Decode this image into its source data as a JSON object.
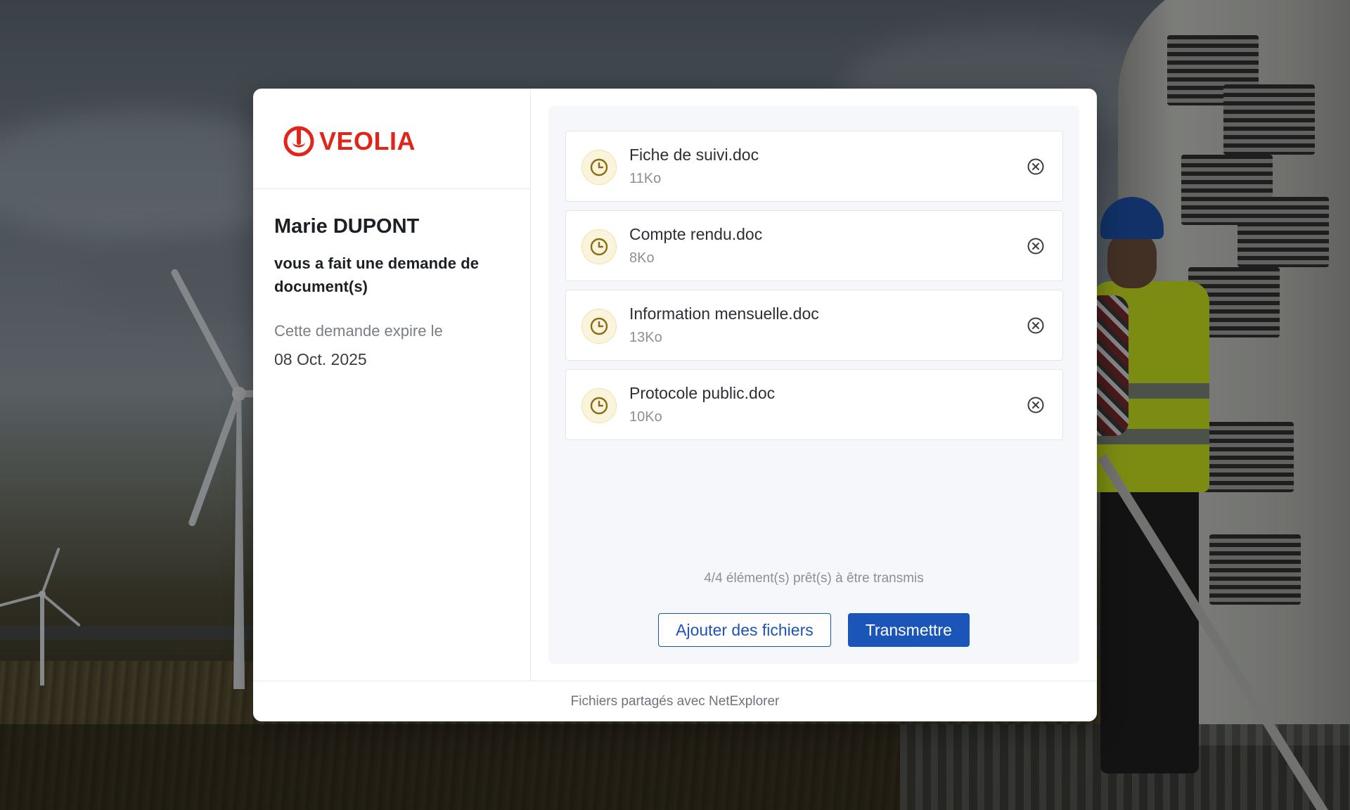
{
  "brand": {
    "name": "VEOLIA",
    "color": "#e1251b"
  },
  "request": {
    "requester_name": "Marie DUPONT",
    "message": "vous a fait une demande de document(s)",
    "expire_label": "Cette demande expire le",
    "expire_date": "08 Oct. 2025"
  },
  "files": [
    {
      "name": "Fiche de suivi.doc",
      "size": "11Ko",
      "status_icon": "clock-icon"
    },
    {
      "name": "Compte rendu.doc",
      "size": "8Ko",
      "status_icon": "clock-icon"
    },
    {
      "name": "Information mensuelle.doc",
      "size": "13Ko",
      "status_icon": "clock-icon"
    },
    {
      "name": "Protocole public.doc",
      "size": "10Ko",
      "status_icon": "clock-icon"
    }
  ],
  "status": {
    "ready_text": "4/4 élément(s) prêt(s) à être transmis"
  },
  "actions": {
    "add_files_label": "Ajouter des fichiers",
    "submit_label": "Transmettre"
  },
  "footer": {
    "text": "Fichiers partagés avec NetExplorer"
  },
  "colors": {
    "accent": "#1b55b8",
    "pending_icon": "#8a6d12",
    "pending_bg": "#fbf4dc"
  }
}
